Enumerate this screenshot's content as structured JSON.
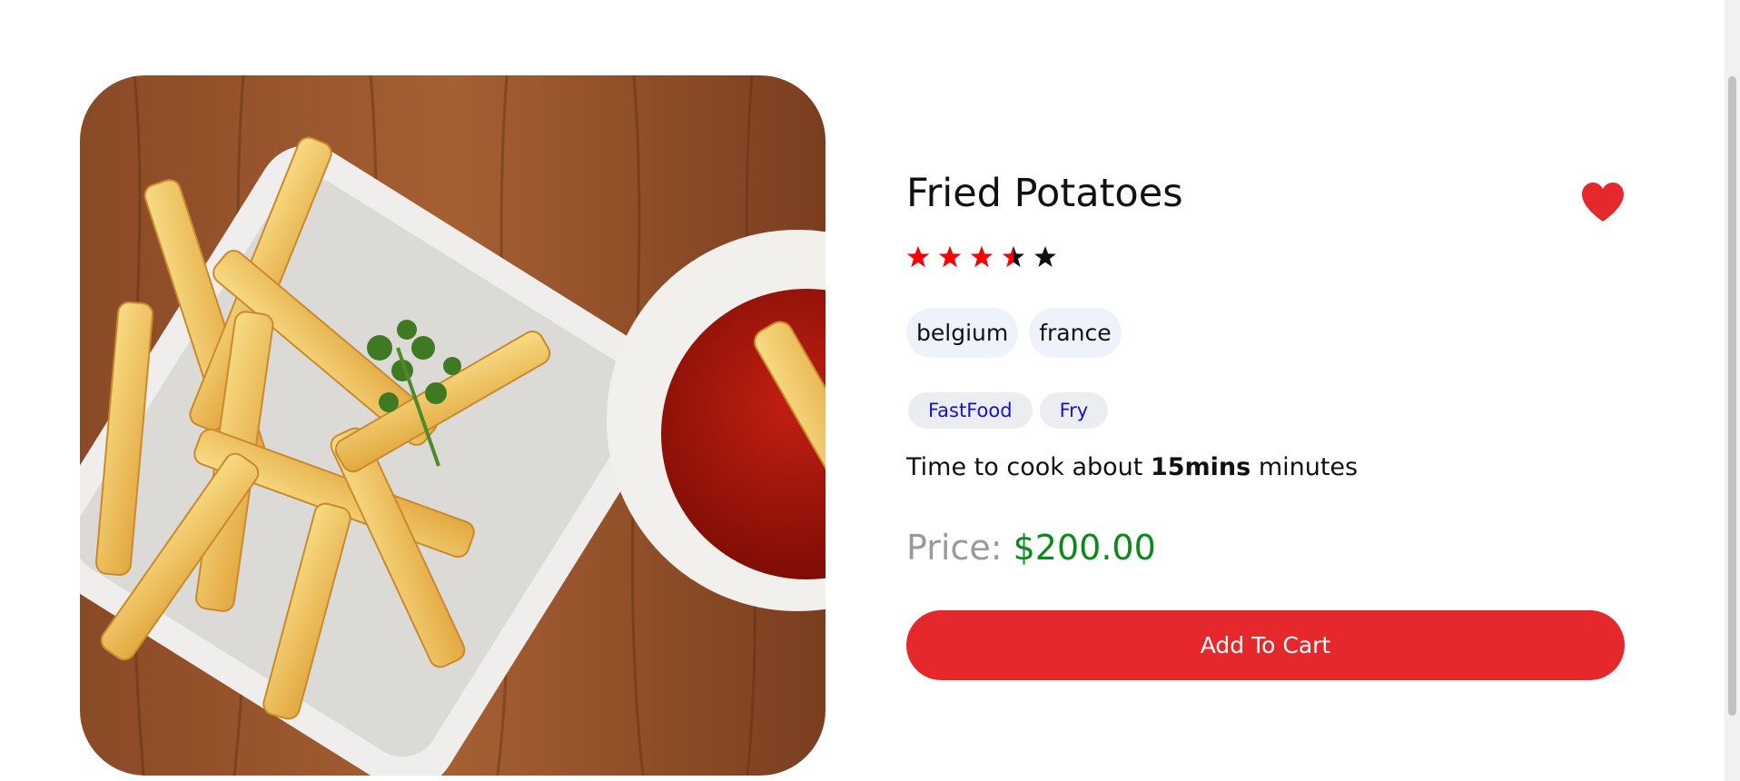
{
  "product": {
    "title": "Fried Potatoes",
    "image_alt": "fried-potatoes-photo",
    "favorite_icon": "heart-icon",
    "favorite_color": "#e5282c",
    "rating": 3.5,
    "rating_max": 5,
    "star_filled_color": "#ff0000",
    "star_empty_color": "#111111",
    "countries": [
      {
        "label": "belgium"
      },
      {
        "label": "france"
      }
    ],
    "tags": [
      {
        "label": "FastFood"
      },
      {
        "label": "Fry"
      }
    ],
    "cook_time": {
      "prefix": "Time to cook about",
      "value": "15mins",
      "suffix": "minutes"
    },
    "price": {
      "label": "Price:",
      "value": "$200.00",
      "value_color": "#0a8a1a"
    },
    "add_to_cart_label": "Add To Cart",
    "button_color": "#e5282c"
  }
}
